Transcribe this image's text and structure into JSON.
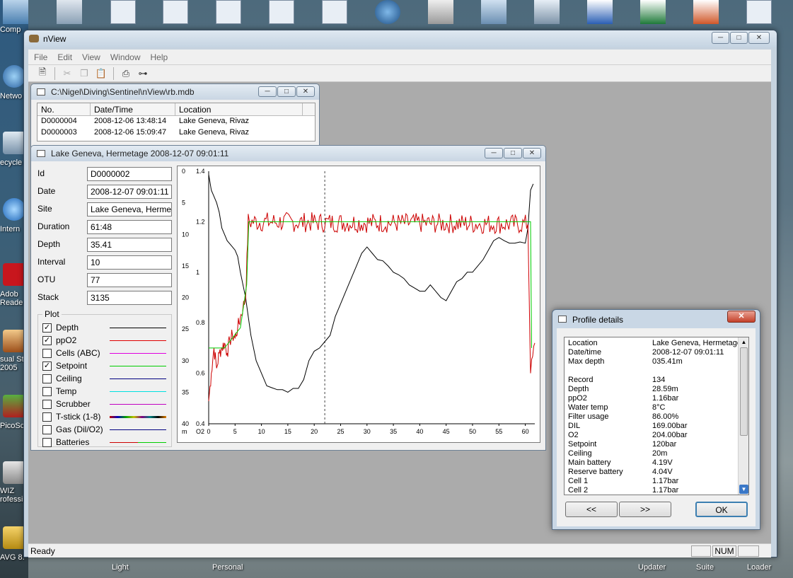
{
  "desktop": {
    "left_labels": [
      "Comp",
      "Netwo",
      "ecycle",
      "Intern",
      "Adob Reade",
      "sual St 2005",
      "PicoSc",
      "WIZ rofessi",
      "AVG 8."
    ],
    "bottom_labels": [
      "Light",
      "Personal",
      "Updater",
      "Suite",
      "Loader"
    ]
  },
  "main_window": {
    "title": "nView",
    "menu": [
      "File",
      "Edit",
      "View",
      "Window",
      "Help"
    ],
    "status": {
      "ready": "Ready",
      "num": "NUM"
    }
  },
  "db_window": {
    "title": "C:\\Nigel\\Diving\\Sentinel\\nView\\rb.mdb",
    "columns": [
      "No.",
      "Date/Time",
      "Location"
    ],
    "rows": [
      [
        "D0000004",
        "2008-12-06 13:48:14",
        "Lake Geneva, Rivaz"
      ],
      [
        "D0000003",
        "2008-12-06 15:09:47",
        "Lake Geneva, Rivaz"
      ]
    ]
  },
  "dive_window": {
    "title": "Lake Geneva, Hermetage 2008-12-07 09:01:11",
    "fields": [
      {
        "label": "Id",
        "value": "D0000002"
      },
      {
        "label": "Date",
        "value": "2008-12-07 09:01:11"
      },
      {
        "label": "Site",
        "value": "Lake Geneva, Hermet"
      },
      {
        "label": "Duration",
        "value": "61:48"
      },
      {
        "label": "Depth",
        "value": "35.41"
      },
      {
        "label": "Interval",
        "value": "10"
      },
      {
        "label": "OTU",
        "value": "77"
      },
      {
        "label": "Stack",
        "value": "3135"
      }
    ],
    "plot_group_label": "Plot",
    "plot_items": [
      {
        "label": "Depth",
        "checked": true,
        "color": "#000000"
      },
      {
        "label": "ppO2",
        "checked": true,
        "color": "#e00000"
      },
      {
        "label": "Cells (ABC)",
        "checked": false,
        "color": "#e000e0"
      },
      {
        "label": "Setpoint",
        "checked": true,
        "color": "#00cc00"
      },
      {
        "label": "Ceiling",
        "checked": false,
        "color": "#000080"
      },
      {
        "label": "Temp",
        "checked": false,
        "color": "#00e0e0"
      },
      {
        "label": "Scrubber",
        "checked": false,
        "color": "#c000c0"
      },
      {
        "label": "T-stick (1-8)",
        "checked": false,
        "color": "multi"
      },
      {
        "label": "Gas (Dil/O2)",
        "checked": false,
        "color": "#000080"
      },
      {
        "label": "Batteries",
        "checked": false,
        "color": "#cc0000"
      }
    ]
  },
  "chart_data": {
    "type": "line",
    "x_ticks": [
      0,
      5,
      10,
      15,
      20,
      25,
      30,
      35,
      40,
      45,
      50,
      55,
      60
    ],
    "xlim": [
      0,
      61.8
    ],
    "depth_ticks": [
      0,
      5,
      10,
      15,
      20,
      25,
      30,
      35,
      40
    ],
    "depth_axis_unit": "m",
    "ppo2_ticks": [
      0.4,
      0.6,
      0.8,
      1.0,
      1.2,
      1.4
    ],
    "ppo2_axis_unit": "O2",
    "cursor_x": 22,
    "series": [
      {
        "key": "depth",
        "color": "#000000",
        "axis": "depth",
        "points": [
          [
            0,
            0.5
          ],
          [
            0.5,
            3
          ],
          [
            1,
            4
          ],
          [
            1.5,
            5
          ],
          [
            2,
            6.5
          ],
          [
            2.5,
            9
          ],
          [
            3,
            10
          ],
          [
            3.5,
            11
          ],
          [
            4,
            11.5
          ],
          [
            4.5,
            12
          ],
          [
            5,
            12.5
          ],
          [
            5.5,
            13.5
          ],
          [
            6,
            16
          ],
          [
            6.5,
            18
          ],
          [
            7,
            20
          ],
          [
            7.5,
            23
          ],
          [
            8,
            26
          ],
          [
            9,
            30
          ],
          [
            10,
            32
          ],
          [
            11,
            34
          ],
          [
            12,
            34.3
          ],
          [
            13,
            34.6
          ],
          [
            14,
            34.6
          ],
          [
            15,
            35
          ],
          [
            16,
            34.4
          ],
          [
            17,
            34.4
          ],
          [
            18,
            33
          ],
          [
            19,
            30
          ],
          [
            20,
            28.5
          ],
          [
            21,
            28
          ],
          [
            22,
            27
          ],
          [
            23,
            26
          ],
          [
            24,
            23
          ],
          [
            25,
            21
          ],
          [
            26,
            19
          ],
          [
            27,
            17
          ],
          [
            28,
            15
          ],
          [
            29,
            13
          ],
          [
            30,
            12
          ],
          [
            31,
            13
          ],
          [
            32,
            14
          ],
          [
            33,
            14.2
          ],
          [
            34,
            15
          ],
          [
            35,
            16
          ],
          [
            36,
            16.4
          ],
          [
            37,
            17
          ],
          [
            38,
            18
          ],
          [
            39,
            18.5
          ],
          [
            40,
            19
          ],
          [
            41,
            19
          ],
          [
            42,
            18
          ],
          [
            43,
            19
          ],
          [
            44,
            20
          ],
          [
            45,
            20.5
          ],
          [
            46,
            19
          ],
          [
            47,
            17.5
          ],
          [
            48,
            17
          ],
          [
            49,
            16
          ],
          [
            50,
            16
          ],
          [
            51,
            15
          ],
          [
            52,
            14
          ],
          [
            53,
            12.5
          ],
          [
            54,
            11
          ],
          [
            55,
            10.5
          ],
          [
            56,
            11
          ],
          [
            57,
            11.4
          ],
          [
            58,
            11.4
          ],
          [
            59,
            11.2
          ],
          [
            60,
            11.4
          ],
          [
            60.5,
            9
          ],
          [
            61,
            3
          ],
          [
            61.5,
            2
          ]
        ]
      },
      {
        "key": "ppo2",
        "color": "#cc0000",
        "axis": "ppo2",
        "noisy_from": 7.5,
        "noise_amplitude": 0.04,
        "jitter_points": 220,
        "points": [
          [
            0,
            0.49
          ],
          [
            0.5,
            0.6
          ],
          [
            1,
            0.7
          ],
          [
            1.5,
            0.62
          ],
          [
            2,
            0.68
          ],
          [
            2.5,
            0.7
          ],
          [
            3,
            0.72
          ],
          [
            3.5,
            0.68
          ],
          [
            4,
            0.73
          ],
          [
            4.5,
            0.75
          ],
          [
            5,
            0.74
          ],
          [
            5.5,
            0.78
          ],
          [
            6,
            0.82
          ],
          [
            6.5,
            0.86
          ],
          [
            7,
            0.9
          ],
          [
            7.5,
            1.2
          ],
          [
            60.5,
            1.19
          ],
          [
            61,
            0.6
          ],
          [
            61.8,
            0.72
          ]
        ]
      },
      {
        "key": "setpoint",
        "color": "#00cc00",
        "axis": "ppo2",
        "points": [
          [
            0,
            0.7
          ],
          [
            3,
            0.7
          ],
          [
            6,
            0.78
          ],
          [
            7.2,
            0.95
          ],
          [
            7.6,
            1.2
          ],
          [
            61,
            1.2
          ],
          [
            61.2,
            0.7
          ]
        ]
      }
    ]
  },
  "profile_dialog": {
    "title": "Profile details",
    "rows": [
      [
        "Location",
        "Lake Geneva, Hermetage"
      ],
      [
        "Date/time",
        "2008-12-07 09:01:11"
      ],
      [
        "Max depth",
        "035.41m"
      ],
      [
        "",
        ""
      ],
      [
        "Record",
        "134"
      ],
      [
        "Depth",
        "28.59m"
      ],
      [
        "ppO2",
        "1.16bar"
      ],
      [
        "Water temp",
        "8°C"
      ],
      [
        "Filter usage",
        "86.00%"
      ],
      [
        "DIL",
        "169.00bar"
      ],
      [
        "O2",
        "204.00bar"
      ],
      [
        "Setpoint",
        "120bar"
      ],
      [
        "Ceiling",
        "20m"
      ],
      [
        "Main battery",
        "4.19V"
      ],
      [
        "Reserve battery",
        "4.04V"
      ],
      [
        "Cell 1",
        "1.17bar"
      ],
      [
        "Cell 2",
        "1.17bar"
      ]
    ],
    "prev_label": "<<",
    "next_label": ">>",
    "ok_label": "OK"
  }
}
